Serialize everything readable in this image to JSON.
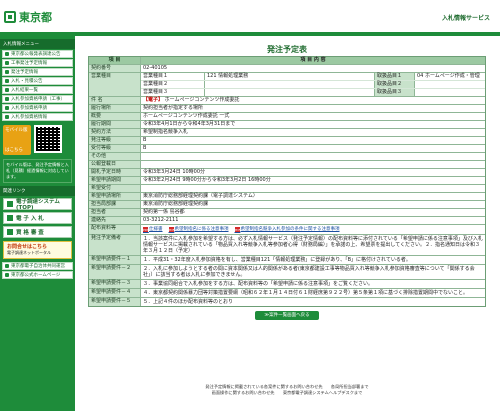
{
  "header": {
    "logo_text": "東京都",
    "site_title": "入札情報サービス"
  },
  "sidebar": {
    "section1": "入札情報メニュー",
    "items": [
      "東京都公報発表調達公告",
      "工事発注予定情報",
      "発注予定情報",
      "入札・見積公告",
      "入札結果一覧",
      "入札参加資格申請（工事）",
      "入札参加資格申請",
      "入札参加資格情報"
    ],
    "mobile_label": "モバイル版",
    "mobile_sub": "はこちら",
    "mobile_note": "モバイル版は、発注予定情報と入札（見積）経過情報に対応しています。",
    "section2": "関連リンク",
    "big_buttons": [
      "電子調達システム(TOP)",
      "電 子 入 札",
      "資 格 審 査"
    ],
    "pamphlet_title": "お問合せはこちら",
    "pamphlet_sub": "電子調達ネットポータル",
    "links": [
      "東京都電子自治体共同運営",
      "東京都公式ホームページ"
    ]
  },
  "main": {
    "title": "発注予定表",
    "header": {
      "label": "項 目",
      "value": "項 目 内 容"
    },
    "rows": {
      "contract_no": {
        "label": "契約番号",
        "value": "02-40105"
      },
      "category1": {
        "label": "営業種目",
        "rows": [
          {
            "name": "営業種目１",
            "code": "121 情報処理業務",
            "name2": "取扱品目１",
            "item": "04 ホームページ作成・管理"
          },
          {
            "name": "営業種目２",
            "code": "",
            "name2": "取扱品目２",
            "item": ""
          },
          {
            "name": "営業種目３",
            "code": "",
            "name2": "取扱品目３",
            "item": ""
          }
        ]
      },
      "subject": {
        "label": "件 名",
        "badge": "【電子】",
        "value": "ホームページコンテンツ作成委託"
      },
      "place": {
        "label": "履行場所",
        "value": "契約担当者が指定する場所"
      },
      "outline": {
        "label": "概要",
        "value": "ホームページコンテンツ作成委託 一式"
      },
      "period": {
        "label": "履行期間",
        "value": "令和3年4月1日から令和4年3月31日まで"
      },
      "method": {
        "label": "契約方法",
        "value": "希望制指名競争入札"
      },
      "order_type": {
        "label": "発注等級",
        "value": "B"
      },
      "accept_type": {
        "label": "受付等級",
        "value": "B"
      },
      "other": {
        "label": "その他",
        "value": ""
      },
      "announce_date": {
        "label": "公報登載日",
        "value": ""
      },
      "open_date": {
        "label": "開札予定日時",
        "value": "令和3年3月24日 10時00分"
      },
      "apply_period": {
        "label": "希望申請期間",
        "value": "令和3年2月24日 9時00分から令和3年3月2日 16時00分"
      },
      "apply_addr": {
        "label": "希望受付",
        "value": ""
      },
      "apply_place": {
        "label": "希望申請場所",
        "value": "東京消防庁総務部経理契約課（電子調達システム）"
      },
      "dept": {
        "label": "担当局部課",
        "value": "東京消防庁総務部経理契約課"
      },
      "person": {
        "label": "担当者",
        "value": "契約第一係 島谷都"
      },
      "tel": {
        "label": "連絡先",
        "value": "03-3212-2111"
      },
      "docs": {
        "label": "配布資料等",
        "items": [
          "仕様書",
          "希望制指名に係る注意事項",
          "希望制指名競争入札参加の条件に関する注意事項"
        ]
      },
      "remarks": {
        "label": "発注予定備考",
        "value": "１．当該案件に入札参加を希望する方は、必ず入札情報サービス（発注予定情報）の配布資料等に添付されている「希望申請に係る注意事項」及び入札情報サービスに掲載されている「物品買入れ等競争入札等参加者心得（財務局編）」を承諾の上、希望票を提出してください。２．指名通知日は令和３年３月１２日（予定）"
      },
      "req1": {
        "label": "希望申請要件－１",
        "value": "１．平成31・32年度入札参加資格を有し、営業種目121「情報処理業務」に登録があり、「B」に格付けされている者。"
      },
      "req2": {
        "label": "希望申請要件－２",
        "value": "２．入札に参加しようとする者の間に資本関係又は人的関係がある者(東京都建設工事等物品買入れ等競争入札参加資格審査等について「関係する会社」）に該当する者は入札に参加できません。"
      },
      "req3": {
        "label": "希望申請要件－３",
        "value": "３．事業協同組合で入札参加をする方は、配布資料等の「希望申請に係る注意事項」をご覧ください。"
      },
      "req4": {
        "label": "希望申請要件－４",
        "value": "４．東京都契約関係暴力団等対策措置要綱（昭和６２年１月１４日付６１財経庶第９２２号）第５条第１項に基づく排除措置期間中でないこと。"
      },
      "req5": {
        "label": "希望申請要件－５",
        "value": "５．上記４件のほか配布資料等のとおり"
      }
    },
    "back_button": "≫案件一覧画面へ戻る"
  },
  "footer": {
    "line1": "発注予定情報に掲載されている各案件に関するお問い合わせ先　　各局所担当部署まで",
    "line2": "画面操作に関するお問い合わせ先　　東京都電子調達システムヘルプデスクまで"
  }
}
